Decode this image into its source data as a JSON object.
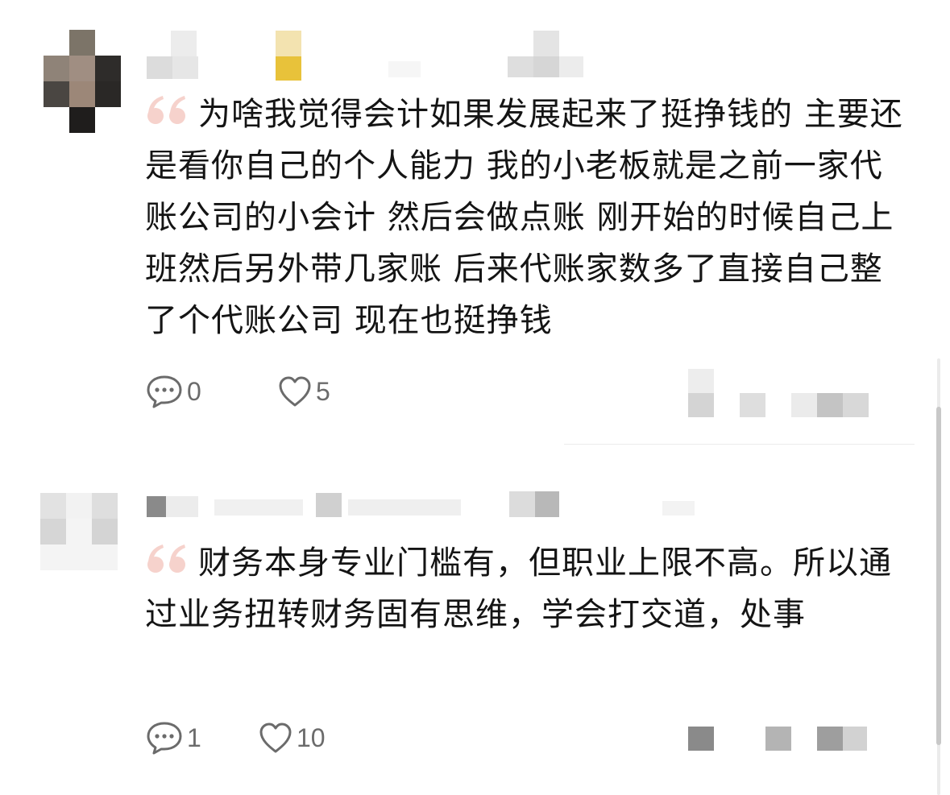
{
  "comments": [
    {
      "text": "为啥我觉得会计如果发展起来了挺挣钱的  主要还是看你自己的个人能力  我的小老板就是之前一家代账公司的小会计  然后会做点账  刚开始的时候自己上班然后另外带几家账  后来代账家数多了直接自己整了个代账公司  现在也挺挣钱",
      "reply_count": "0",
      "like_count": "5"
    },
    {
      "text": "财务本身专业门槛有，但职业上限不高。所以通过业务扭转财务固有思维，学会打交道，处事",
      "reply_count": "1",
      "like_count": "10"
    }
  ],
  "icons": {
    "quote": "quote-mark-icon",
    "reply": "comment-bubble-icon",
    "like": "heart-outline-icon"
  },
  "colors": {
    "quote_mark": "#f6d2cc",
    "icon_gray": "#6b6b6b",
    "text": "#141414",
    "badge_yellow": "#e8c23a"
  }
}
